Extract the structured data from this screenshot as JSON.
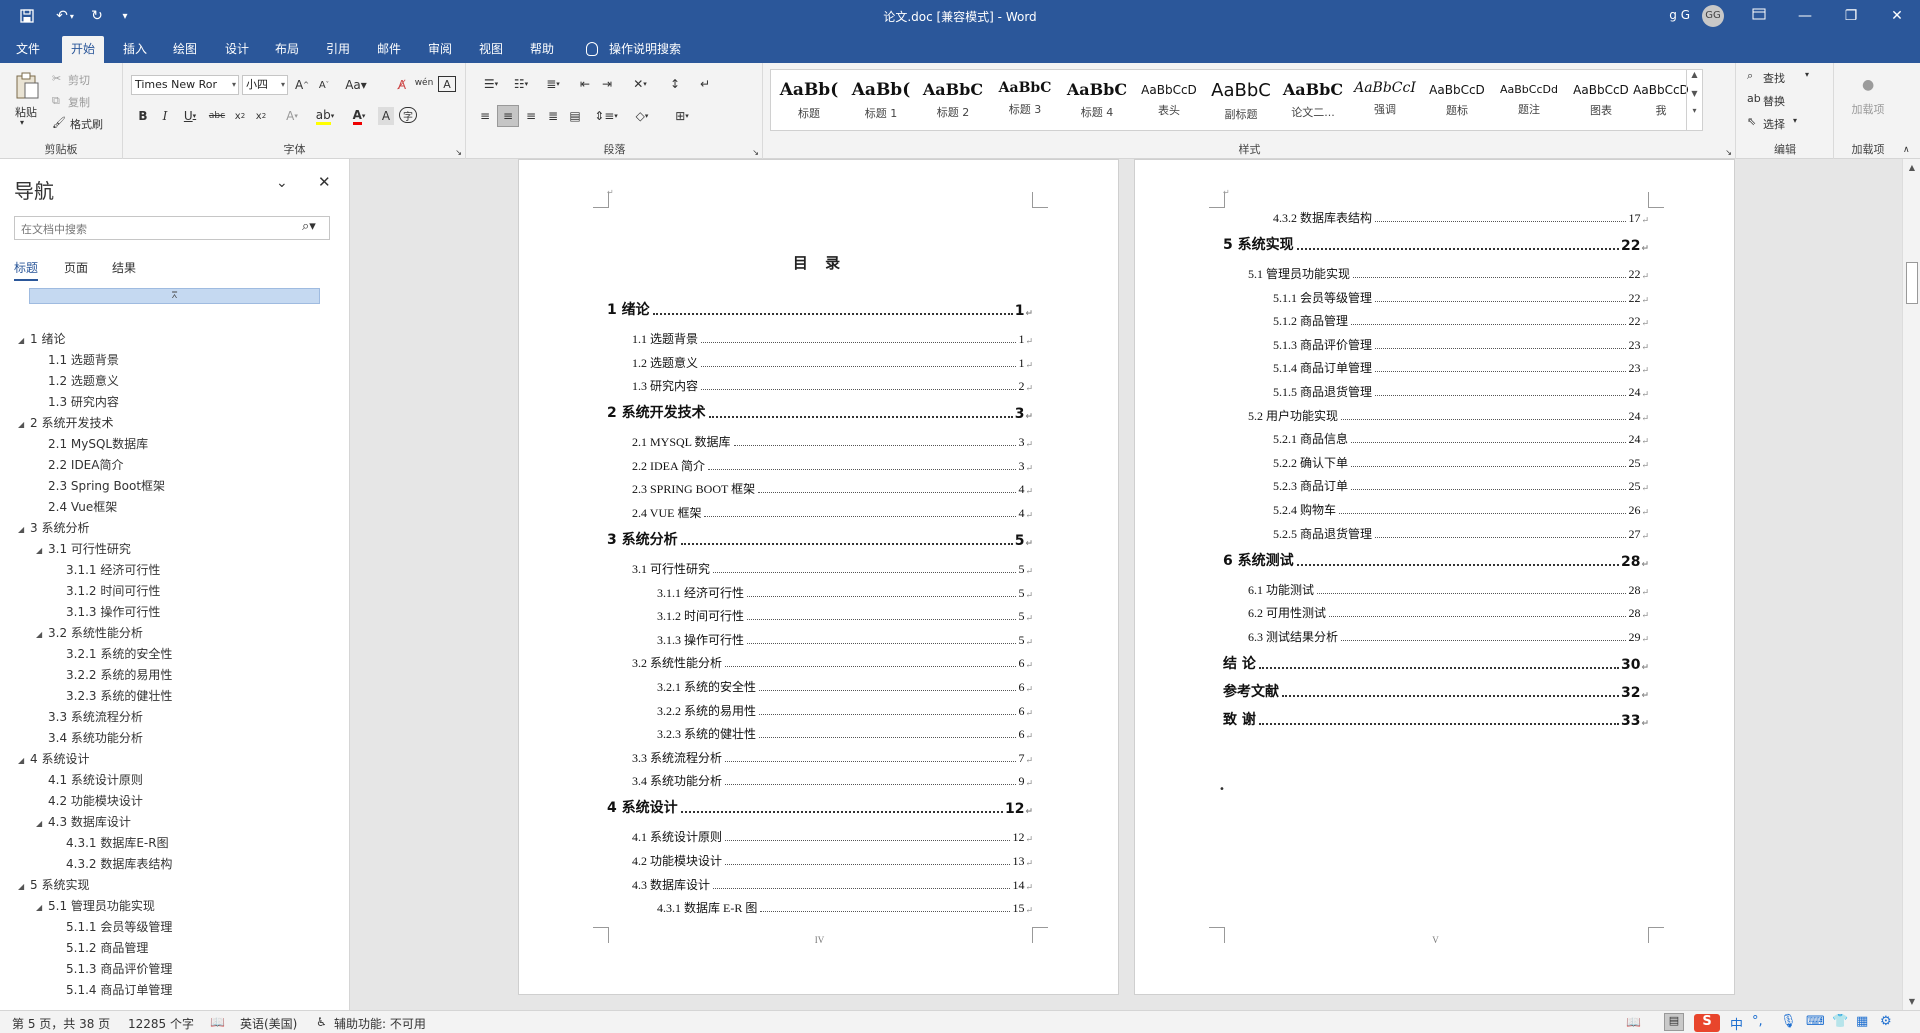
{
  "titlebar": {
    "document_title": "论文.doc [兼容模式]  -  Word",
    "user": "g G",
    "avatar": "GG",
    "icons": [
      "save-icon",
      "undo-icon",
      "redo-icon",
      "customize-icon"
    ],
    "window_buttons": [
      "ribbon-display-icon",
      "minimize-icon",
      "restore-icon",
      "close-icon"
    ]
  },
  "tabs": [
    "文件",
    "开始",
    "插入",
    "绘图",
    "设计",
    "布局",
    "引用",
    "邮件",
    "审阅",
    "视图",
    "帮助"
  ],
  "active_tab": "开始",
  "tell_me": "操作说明搜索",
  "ribbon": {
    "clipboard": {
      "paste": "粘贴",
      "cut": "剪切",
      "copy": "复制",
      "format_painter": "格式刷",
      "label": "剪贴板"
    },
    "font": {
      "font_name": "Times New Ror",
      "font_size": "小四",
      "label": "字体"
    },
    "paragraph": {
      "label": "段落"
    },
    "styles": {
      "label": "样式",
      "items": [
        {
          "preview": "AaBb(",
          "name": "标题"
        },
        {
          "preview": "AaBb(",
          "name": "标题 1"
        },
        {
          "preview": "AaBbC",
          "name": "标题 2"
        },
        {
          "preview": "AaBbC",
          "name": "标题 3"
        },
        {
          "preview": "AaBbC",
          "name": "标题 4"
        },
        {
          "preview": "AaBbCcD",
          "name": "表头"
        },
        {
          "preview": "AaBbC",
          "name": "副标题"
        },
        {
          "preview": "AaBbC",
          "name": "论文二..."
        },
        {
          "preview": "AaBbCcI",
          "name": "强调"
        },
        {
          "preview": "AaBbCcD",
          "name": "题标"
        },
        {
          "preview": "AaBbCcDd",
          "name": "题注"
        },
        {
          "preview": "AaBbCcD",
          "name": "图表"
        },
        {
          "preview": "AaBbCcD",
          "name": "我"
        }
      ]
    },
    "editing": {
      "find": "查找",
      "replace": "替换",
      "select": "选择",
      "label": "编辑"
    },
    "addins": {
      "button": "加载项",
      "label": "加载项"
    }
  },
  "nav": {
    "title": "导航",
    "search_placeholder": "在文档中搜索",
    "tabs": [
      "标题",
      "页面",
      "结果"
    ],
    "tree": [
      {
        "level": 1,
        "text": "1 绪论",
        "expanded": true
      },
      {
        "level": 2,
        "text": "1.1 选题背景"
      },
      {
        "level": 2,
        "text": "1.2 选题意义"
      },
      {
        "level": 2,
        "text": "1.3 研究内容"
      },
      {
        "level": 1,
        "text": "2 系统开发技术",
        "expanded": true
      },
      {
        "level": 2,
        "text": "2.1 MySQL数据库"
      },
      {
        "level": 2,
        "text": "2.2 IDEA简介"
      },
      {
        "level": 2,
        "text": "2.3 Spring Boot框架"
      },
      {
        "level": 2,
        "text": "2.4 Vue框架"
      },
      {
        "level": 1,
        "text": "3 系统分析",
        "expanded": true
      },
      {
        "level": 2,
        "text": "3.1 可行性研究",
        "expanded": true
      },
      {
        "level": 3,
        "text": "3.1.1 经济可行性"
      },
      {
        "level": 3,
        "text": "3.1.2 时间可行性"
      },
      {
        "level": 3,
        "text": "3.1.3 操作可行性"
      },
      {
        "level": 2,
        "text": "3.2 系统性能分析",
        "expanded": true
      },
      {
        "level": 3,
        "text": "3.2.1 系统的安全性"
      },
      {
        "level": 3,
        "text": "3.2.2 系统的易用性"
      },
      {
        "level": 3,
        "text": "3.2.3 系统的健壮性"
      },
      {
        "level": 2,
        "text": "3.3 系统流程分析"
      },
      {
        "level": 2,
        "text": "3.4 系统功能分析"
      },
      {
        "level": 1,
        "text": "4 系统设计",
        "expanded": true
      },
      {
        "level": 2,
        "text": "4.1 系统设计原则"
      },
      {
        "level": 2,
        "text": "4.2 功能模块设计"
      },
      {
        "level": 2,
        "text": "4.3 数据库设计",
        "expanded": true
      },
      {
        "level": 3,
        "text": "4.3.1 数据库E-R图"
      },
      {
        "level": 3,
        "text": "4.3.2 数据库表结构"
      },
      {
        "level": 1,
        "text": "5 系统实现",
        "expanded": true
      },
      {
        "level": 2,
        "text": "5.1 管理员功能实现",
        "expanded": true
      },
      {
        "level": 3,
        "text": "5.1.1 会员等级管理"
      },
      {
        "level": 3,
        "text": "5.1.2 商品管理"
      },
      {
        "level": 3,
        "text": "5.1.3 商品评价管理"
      },
      {
        "level": 3,
        "text": "5.1.4 商品订单管理"
      }
    ]
  },
  "page_left": {
    "title": "目  录",
    "footer": "IV",
    "toc": [
      {
        "level": 1,
        "text": "1  绪论",
        "page": "1"
      },
      {
        "level": 2,
        "text": "1.1 选题背景",
        "page": "1"
      },
      {
        "level": 2,
        "text": "1.2 选题意义",
        "page": "1"
      },
      {
        "level": 2,
        "text": "1.3 研究内容",
        "page": "2"
      },
      {
        "level": 1,
        "text": "2  系统开发技术",
        "page": "3"
      },
      {
        "level": 2,
        "text": "2.1 MYSQL 数据库",
        "page": "3"
      },
      {
        "level": 2,
        "text": "2.2 IDEA 简介",
        "page": "3"
      },
      {
        "level": 2,
        "text": "2.3 SPRING BOOT 框架",
        "page": "4"
      },
      {
        "level": 2,
        "text": "2.4 VUE 框架",
        "page": "4"
      },
      {
        "level": 1,
        "text": "3  系统分析",
        "page": "5"
      },
      {
        "level": 2,
        "text": "3.1 可行性研究",
        "page": "5"
      },
      {
        "level": 3,
        "text": "3.1.1  经济可行性",
        "page": "5"
      },
      {
        "level": 3,
        "text": "3.1.2  时间可行性",
        "page": "5"
      },
      {
        "level": 3,
        "text": "3.1.3  操作可行性",
        "page": "5"
      },
      {
        "level": 2,
        "text": "3.2 系统性能分析",
        "page": "6"
      },
      {
        "level": 3,
        "text": "3.2.1  系统的安全性",
        "page": "6"
      },
      {
        "level": 3,
        "text": "3.2.2  系统的易用性",
        "page": "6"
      },
      {
        "level": 3,
        "text": "3.2.3  系统的健壮性",
        "page": "6"
      },
      {
        "level": 2,
        "text": "3.3 系统流程分析",
        "page": "7"
      },
      {
        "level": 2,
        "text": "3.4 系统功能分析",
        "page": "9"
      },
      {
        "level": 1,
        "text": "4  系统设计",
        "page": "12"
      },
      {
        "level": 2,
        "text": "4.1 系统设计原则",
        "page": "12"
      },
      {
        "level": 2,
        "text": "4.2 功能模块设计",
        "page": "13"
      },
      {
        "level": 2,
        "text": "4.3 数据库设计",
        "page": "14"
      },
      {
        "level": 3,
        "text": "4.3.1  数据库 E-R 图",
        "page": "15"
      }
    ]
  },
  "page_right": {
    "footer": "V",
    "toc": [
      {
        "level": 3,
        "text": "4.3.2  数据库表结构",
        "page": "17"
      },
      {
        "level": 1,
        "text": "5  系统实现",
        "page": "22"
      },
      {
        "level": 2,
        "text": "5.1 管理员功能实现",
        "page": "22"
      },
      {
        "level": 3,
        "text": "5.1.1  会员等级管理",
        "page": "22"
      },
      {
        "level": 3,
        "text": "5.1.2  商品管理",
        "page": "22"
      },
      {
        "level": 3,
        "text": "5.1.3  商品评价管理",
        "page": "23"
      },
      {
        "level": 3,
        "text": "5.1.4  商品订单管理",
        "page": "23"
      },
      {
        "level": 3,
        "text": "5.1.5  商品退货管理",
        "page": "24"
      },
      {
        "level": 2,
        "text": "5.2 用户功能实现",
        "page": "24"
      },
      {
        "level": 3,
        "text": "5.2.1  商品信息",
        "page": "24"
      },
      {
        "level": 3,
        "text": "5.2.2  确认下单",
        "page": "25"
      },
      {
        "level": 3,
        "text": "5.2.3  商品订单",
        "page": "25"
      },
      {
        "level": 3,
        "text": "5.2.4  购物车",
        "page": "26"
      },
      {
        "level": 3,
        "text": "5.2.5  商品退货管理",
        "page": "27"
      },
      {
        "level": 1,
        "text": "6  系统测试",
        "page": "28"
      },
      {
        "level": 2,
        "text": "6.1 功能测试",
        "page": "28"
      },
      {
        "level": 2,
        "text": "6.2 可用性测试",
        "page": "28"
      },
      {
        "level": 2,
        "text": "6.3 测试结果分析",
        "page": "29"
      },
      {
        "level": 1,
        "text": "结    论",
        "page": "30"
      },
      {
        "level": 1,
        "text": "参考文献",
        "page": "32"
      },
      {
        "level": 1,
        "text": "致    谢",
        "page": "33"
      }
    ]
  },
  "status": {
    "page": "第 5 页，共 38 页",
    "words": "12285 个字",
    "language": "英语(美国)",
    "accessibility": "辅助功能: 不可用",
    "ime": "中"
  },
  "colors": {
    "accent": "#2b579a",
    "ribbon_bg": "#f3f3f3",
    "nav_selected": "#c5d9f1"
  }
}
